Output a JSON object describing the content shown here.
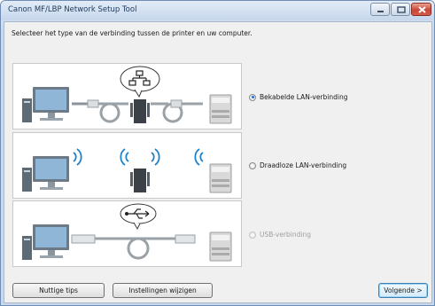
{
  "window": {
    "title": "Canon MF/LBP Network Setup Tool",
    "controls": {
      "minimize_icon": "minimize-icon",
      "maximize_icon": "maximize-icon",
      "close_icon": "close-icon"
    }
  },
  "instruction": "Selecteer het type van de verbinding tussen de printer en uw computer.",
  "options": [
    {
      "label": "Bekabelde LAN-verbinding",
      "selected": true,
      "enabled": true
    },
    {
      "label": "Draadloze LAN-verbinding",
      "selected": false,
      "enabled": true
    },
    {
      "label": "USB-verbinding",
      "selected": false,
      "enabled": false
    }
  ],
  "illustrations": [
    "wired-lan-illustration",
    "wireless-lan-illustration",
    "usb-illustration"
  ],
  "buttons": {
    "tips": "Nuttige tips",
    "settings": "Instellingen wijzigen",
    "next": "Volgende >"
  },
  "colors": {
    "titlebar": "#c5d6ec",
    "close_button": "#c9473a",
    "radio_selected": "#1f6fd1"
  }
}
